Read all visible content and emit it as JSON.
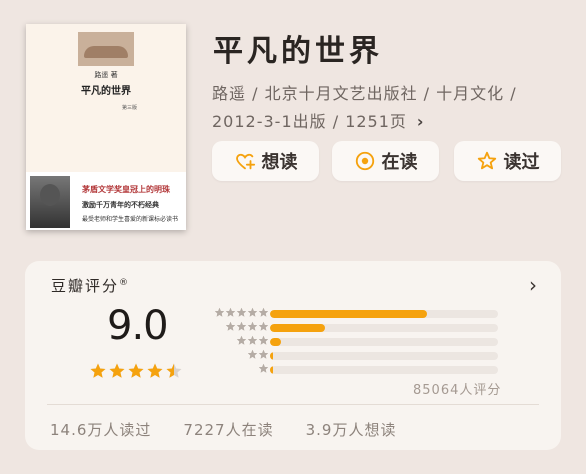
{
  "book": {
    "title": "平凡的世界",
    "meta_line1": "路遥 / 北京十月文艺出版社 / 十月文化 /",
    "meta_line2": "2012-3-1出版 / 1251页",
    "chevron": "›"
  },
  "cover": {
    "author": "路遥 著",
    "title": "平凡的世界",
    "edition": "第三版",
    "line1": "茅盾文学奖皇冠上的明珠",
    "line2": "激励千万青年的不朽经典",
    "line3": "最受老师和学生喜爱的新课标必读书"
  },
  "actions": {
    "want": "想读",
    "reading": "在读",
    "read": "读过"
  },
  "rating": {
    "label": "豆瓣评分",
    "reg": "®",
    "chevron": "›",
    "score": "9.0",
    "stars_value": 4.5,
    "distribution": [
      0.69,
      0.24,
      0.05,
      0.01,
      0.01
    ],
    "count_text": "85064人评分"
  },
  "stats": {
    "read": "14.6万人读过",
    "reading": "7227人在读",
    "want": "3.9万人想读"
  },
  "colors": {
    "accent": "#f5a20e",
    "background": "#efe6e1",
    "card": "#f8f4f0"
  }
}
